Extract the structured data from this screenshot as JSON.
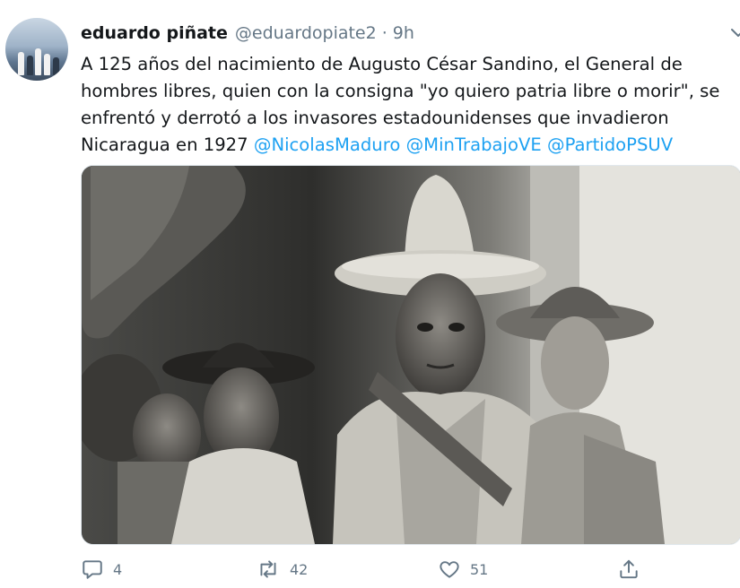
{
  "tweet": {
    "author_name": "eduardo piñate",
    "author_handle": "@eduardopiate2",
    "separator": "·",
    "time": "9h",
    "text_lines": [
      "A 125 años del nacimiento de Augusto César Sandino, el General de",
      "hombres libres, quien con la consigna \"yo quiero patria libre o morir\", se",
      "enfrentó y derrotó a los invasores estadounidenses que invadieron",
      "Nicaragua en 1927 "
    ],
    "mentions": [
      "@NicolasMaduro",
      "@MinTrabajoVE",
      "@PartidoPSUV"
    ],
    "stats": {
      "replies": "4",
      "retweets": "42",
      "likes": "51"
    }
  },
  "icons": {
    "reply": "reply-icon",
    "retweet": "retweet-icon",
    "like": "heart-icon",
    "share": "share-icon",
    "more": "chevron-down-icon"
  },
  "colors": {
    "text": "#14171a",
    "secondary": "#657786",
    "link": "#1da1f2"
  }
}
